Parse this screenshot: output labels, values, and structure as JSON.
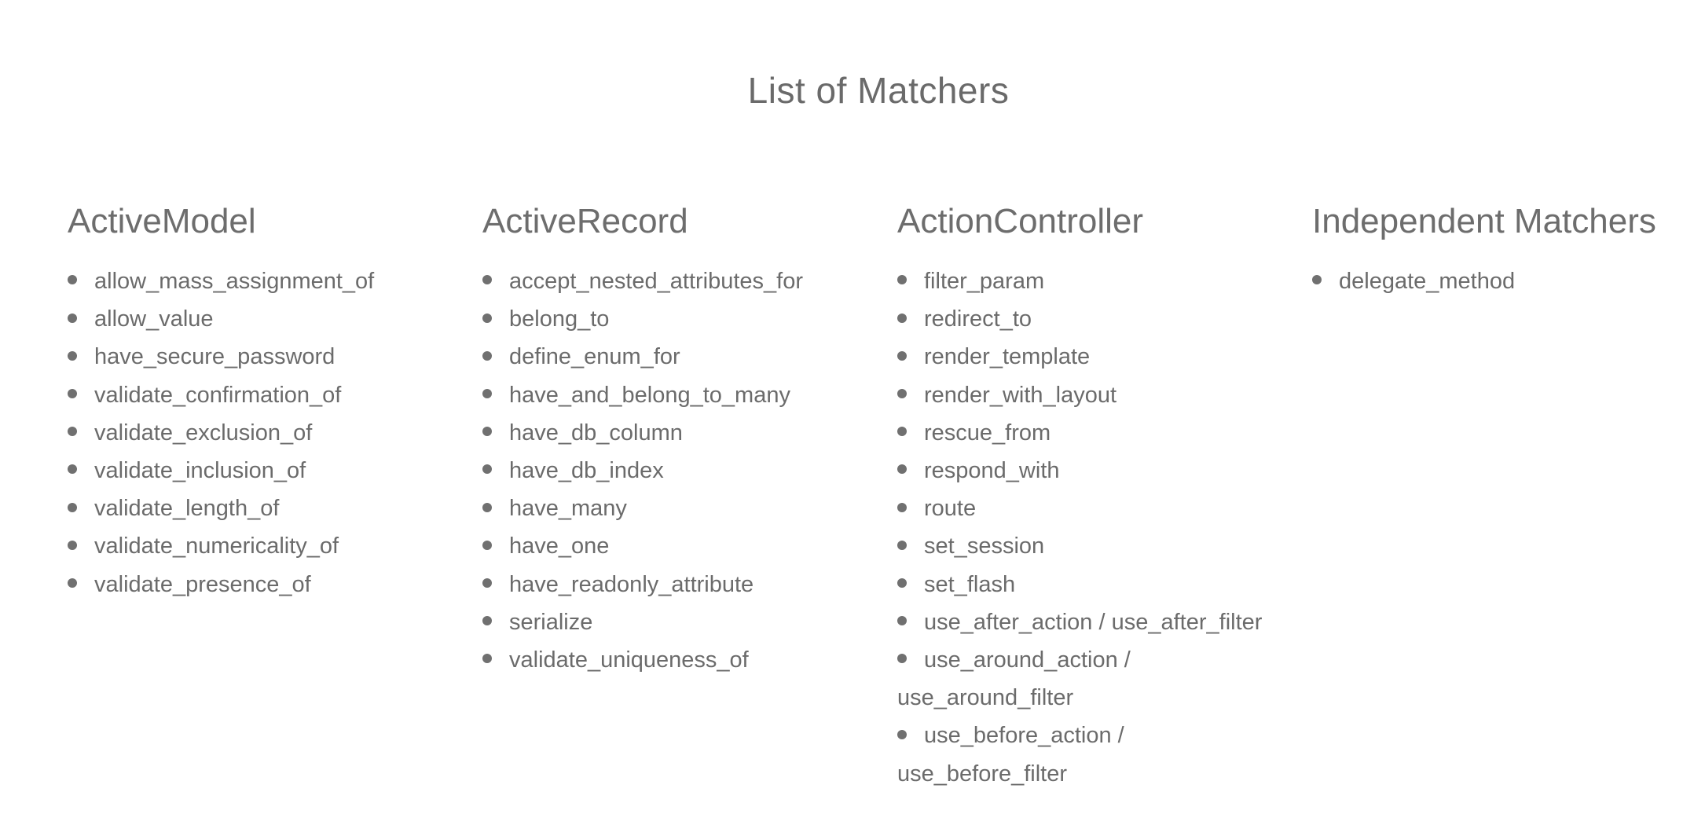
{
  "title": "List of Matchers",
  "columns": [
    {
      "heading": "ActiveModel",
      "items": [
        "allow_mass_assignment_of",
        "allow_value",
        "have_secure_password",
        "validate_confirmation_of",
        "validate_exclusion_of",
        "validate_inclusion_of",
        "validate_length_of",
        "validate_numericality_of",
        "validate_presence_of"
      ]
    },
    {
      "heading": "ActiveRecord",
      "items": [
        "accept_nested_attributes_for",
        "belong_to",
        "define_enum_for",
        "have_and_belong_to_many",
        "have_db_column",
        "have_db_index",
        "have_many",
        "have_one",
        "have_readonly_attribute",
        "serialize",
        "validate_uniqueness_of"
      ]
    },
    {
      "heading": "ActionController",
      "items": [
        "filter_param",
        "redirect_to",
        "render_template",
        "render_with_layout",
        "rescue_from",
        "respond_with",
        "route",
        "set_session",
        "set_flash",
        "use_after_action / use_after_filter",
        "use_around_action / use_around_filter",
        "use_before_action / use_before_filter"
      ]
    },
    {
      "heading": "Independent Matchers",
      "items": [
        "delegate_method"
      ]
    }
  ]
}
